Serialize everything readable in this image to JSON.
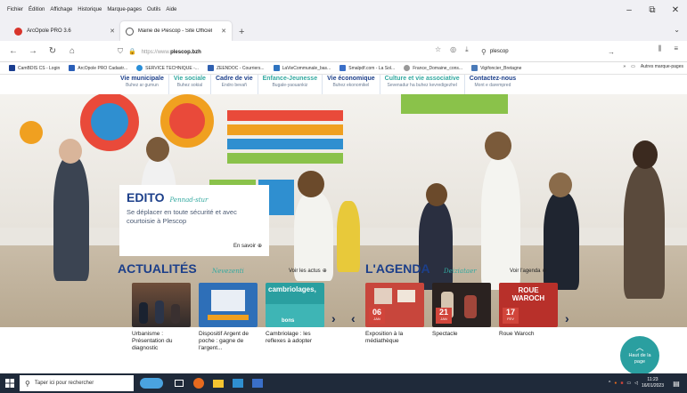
{
  "browser": {
    "menu": [
      "Fichier",
      "Édition",
      "Affichage",
      "Historique",
      "Marque-pages",
      "Outils",
      "Aide"
    ],
    "tabs": [
      {
        "label": "ArcOpole PRO 3.6",
        "active": false
      },
      {
        "label": "Mairie de Plescop - Site Officiel",
        "active": true
      }
    ],
    "url_proto": "https://www.",
    "url_host": "plescop.bzh",
    "search_value": "plescop",
    "bookmarks": [
      "CamBDIS CS - Login",
      "ArcOpole PRO Cadastr...",
      "SERVICE TECHNIQUE -...",
      "ZEENDOC - Courriers...",
      "LaVieCommunale_bas...",
      "Smalpdf.com - La Sol...",
      "France_Domaine_cons...",
      "Vigifoncier_Bretagne"
    ],
    "bookmarks_other": "Autres marque-pages"
  },
  "site": {
    "nav": [
      {
        "title": "Vie municipale",
        "sub": "Buhez ar gumun",
        "color": "#1c3f8a"
      },
      {
        "title": "Vie sociale",
        "sub": "Buhez sokial",
        "color": "#33a9a0"
      },
      {
        "title": "Cadre de vie",
        "sub": "Endro bevañ",
        "color": "#1c3f8a"
      },
      {
        "title": "Enfance-Jeunesse",
        "sub": "Bugale-yaouankiz",
        "color": "#33a9a0"
      },
      {
        "title": "Vie économique",
        "sub": "Buhez ekonomikel",
        "color": "#1c3f8a"
      },
      {
        "title": "Culture et vie associative",
        "sub": "Sevenadur ha buhez kevredigezhel",
        "color": "#33a9a0"
      },
      {
        "title": "Contactez-nous",
        "sub": "Mont e darempred",
        "color": "#1c3f8a"
      }
    ],
    "edito": {
      "title": "EDITO",
      "script": "Pennad-stur",
      "text": "Se déplacer en toute sécurité et avec courtoisie à Plescop",
      "more": "En savoir"
    },
    "actualites": {
      "title": "ACTUALITÉS",
      "script": "Nevezenti",
      "link": "Voir les actus",
      "cards": [
        {
          "caption": "Urbanisme : Présentation du diagnostic"
        },
        {
          "caption": "Dispositif Argent de poche : gagne de l'argent..."
        },
        {
          "caption": "Cambriolage : les reflexes à adopter",
          "img_text": "cambriolages,",
          "img_sub": "bons"
        }
      ]
    },
    "agenda": {
      "title": "L'AGENDA",
      "script": "Deiziataer",
      "link": "Voir l'agenda",
      "cards": [
        {
          "caption": "Exposition à la médiathèque",
          "day": "06",
          "month": "JAN"
        },
        {
          "caption": "Spectacle",
          "day": "21",
          "month": "JAN"
        },
        {
          "caption": "Roue Waroch",
          "day": "17",
          "month": "FEV",
          "img_text": "ROUE WAROCH"
        }
      ]
    },
    "back_to_top": "Haut de la page"
  },
  "taskbar": {
    "search_placeholder": "Taper ici pour rechercher",
    "time": "11:23",
    "date": "16/01/2023"
  },
  "colors": {
    "brand_blue": "#1c3f8a",
    "brand_teal": "#33a9a0",
    "badge_red": "#d1453b"
  }
}
